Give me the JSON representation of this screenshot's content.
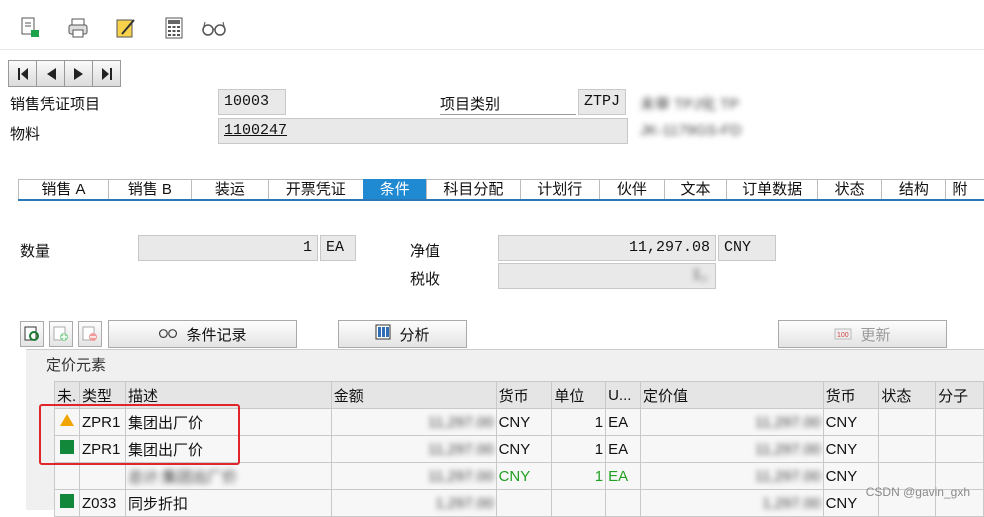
{
  "toolbar": {
    "icons": [
      "document-list-icon",
      "print-icon",
      "edit-note-icon",
      "calculator-icon",
      "glasses-icon"
    ]
  },
  "header": {
    "item_label": "销售凭证项目",
    "item_value": "10003",
    "item_type_label": "项目类别",
    "item_type_value": "ZTPJ",
    "item_type_desc": "未审 TPJ化 TP",
    "material_label": "物料",
    "material_value": "1100247",
    "material_desc": "JK-1179GS-FD"
  },
  "tabs": [
    "销售 A",
    "销售 B",
    "装运",
    "开票凭证",
    "条件",
    "科目分配",
    "计划行",
    "伙伴",
    "文本",
    "订单数据",
    "状态",
    "结构",
    "附"
  ],
  "active_tab": "条件",
  "quantity": {
    "qty_label": "数量",
    "qty_value": "1",
    "qty_unit": "EA",
    "net_label": "净值",
    "net_value": "11,297.08",
    "net_currency": "CNY",
    "tax_label": "税收",
    "tax_value": "1,"
  },
  "buttons": {
    "condition_record": "条件记录",
    "analysis": "分析",
    "update": "更新"
  },
  "pricing": {
    "title": "定价元素",
    "columns": [
      "未.",
      "类型",
      "描述",
      "金额",
      "货币",
      "单位",
      "U...",
      "定价值",
      "货币",
      "状态",
      "分子"
    ],
    "rows": [
      {
        "status": "yellow-triangle",
        "type": "ZPR1",
        "desc": "集团出厂价",
        "amount": "11,297.00",
        "currency": "CNY",
        "unit": "1",
        "uom": "EA",
        "cond_value": "11,297.00",
        "cond_currency": "CNY"
      },
      {
        "status": "green-square",
        "type": "ZPR1",
        "desc": "集团出厂价",
        "amount": "11,297.00",
        "currency": "CNY",
        "unit": "1",
        "uom": "EA",
        "cond_value": "11,297.00",
        "cond_currency": "CNY"
      },
      {
        "status": "",
        "type": "",
        "desc": "总计:集团出厂价",
        "amount": "11,297.00",
        "currency": "CNY",
        "unit": "1",
        "uom": "EA",
        "cond_value": "11,297.00",
        "cond_currency": "CNY"
      },
      {
        "status": "green-square",
        "type": "Z033",
        "desc": "同步折扣",
        "amount": "1,297.00",
        "currency": "",
        "unit": "",
        "uom": "",
        "cond_value": "1,297.00",
        "cond_currency": "CNY"
      }
    ]
  },
  "watermark": "CSDN @gavin_gxh",
  "colors": {
    "accent": "#1f89d2",
    "highlight_box": "#e0262a",
    "total_row": "#22a022",
    "status_green": "#12883a",
    "status_yellow": "#f0a500"
  }
}
